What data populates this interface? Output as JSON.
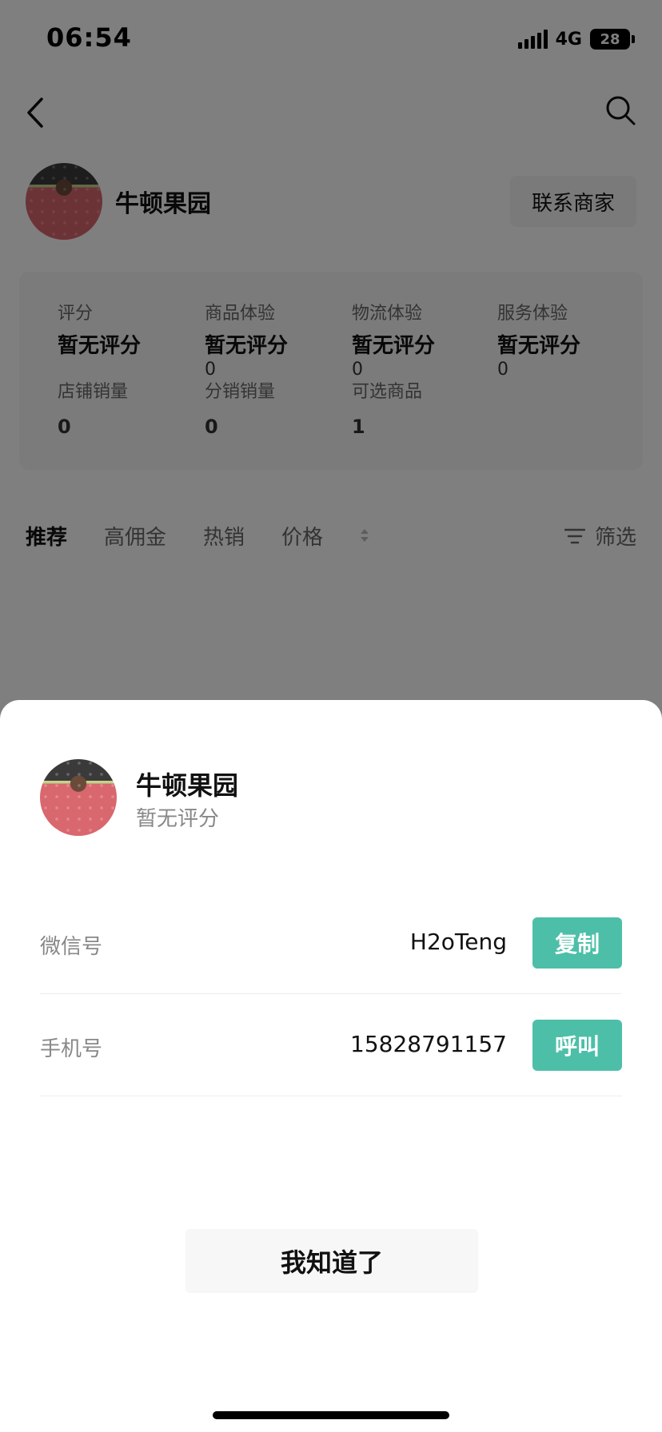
{
  "status_bar": {
    "time": "06:54",
    "network": "4G",
    "battery": "28"
  },
  "shop": {
    "name": "牛顿果园",
    "contact_button": "联系商家",
    "stats": [
      {
        "label": "评分",
        "value": "暂无评分",
        "sub": ""
      },
      {
        "label": "商品体验",
        "value": "暂无评分",
        "sub": "0"
      },
      {
        "label": "物流体验",
        "value": "暂无评分",
        "sub": "0"
      },
      {
        "label": "服务体验",
        "value": "暂无评分",
        "sub": "0"
      }
    ],
    "stats2": [
      {
        "label": "店铺销量",
        "value": "0"
      },
      {
        "label": "分销销量",
        "value": "0"
      },
      {
        "label": "可选商品",
        "value": "1"
      }
    ]
  },
  "tabs": {
    "items": [
      "推荐",
      "高佣金",
      "热销",
      "价格"
    ],
    "active": "推荐",
    "filter_label": "筛选"
  },
  "sheet": {
    "name": "牛顿果园",
    "rating": "暂无评分",
    "wechat": {
      "label": "微信号",
      "value": "H2oTeng",
      "button": "复制"
    },
    "phone": {
      "label": "手机号",
      "value": "15828791157",
      "button": "呼叫"
    },
    "acknowledge_button": "我知道了"
  },
  "colors": {
    "accent": "#4dbfa8",
    "overlay": "rgba(0,0,0,0.5)"
  },
  "icons": [
    "back-icon",
    "search-icon",
    "filter-icon",
    "sort-icon"
  ]
}
